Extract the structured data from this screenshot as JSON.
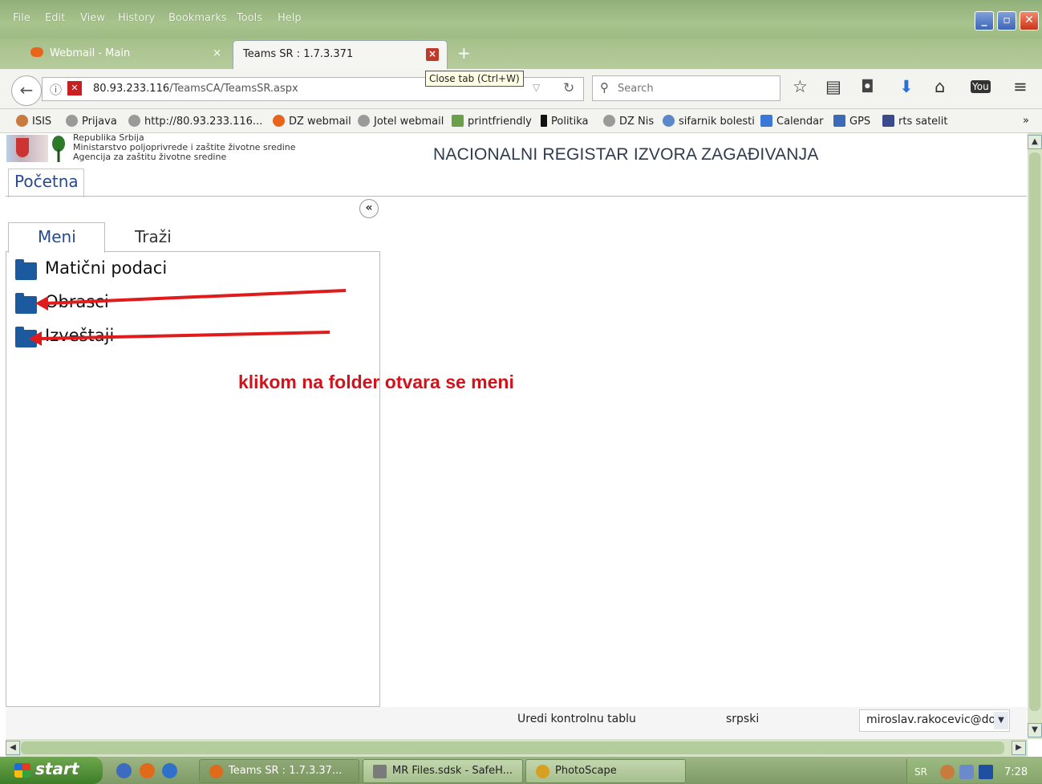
{
  "window": {
    "menu": [
      "File",
      "Edit",
      "View",
      "History",
      "Bookmarks",
      "Tools",
      "Help"
    ],
    "controls": {
      "minimize": "_",
      "restore": "▫",
      "close": "✕"
    }
  },
  "tabs": [
    {
      "label": "Webmail - Main",
      "close": "×"
    },
    {
      "label": "Teams SR : 1.7.3.371",
      "close": "×"
    }
  ],
  "new_tab_label": "+",
  "tooltip": "Close tab (Ctrl+W)",
  "urlbar": {
    "host": "80.93.233.116",
    "path": "/TeamsCA/TeamsSR.aspx"
  },
  "search": {
    "placeholder": "Search"
  },
  "bookmarks": [
    "ISIS",
    "Prijava",
    "http://80.93.233.116...",
    "DZ webmail",
    "Jotel webmail",
    "printfriendly",
    "Politika",
    "DZ Nis",
    "sifarnik bolesti",
    "Calendar",
    "GPS",
    "rts satelit"
  ],
  "bookmarks_overflow": "»",
  "header": {
    "institution": [
      "Republika Srbija",
      "Ministarstvo poljoprivrede i zaštite životne sredine",
      "Agencija za zaštitu životne sredine"
    ],
    "title": "NACIONALNI REGISTAR IZVORA ZAGAĐIVANJA"
  },
  "page_tab": "Početna",
  "collapse_label": "«",
  "subtabs": [
    "Meni",
    "Traži"
  ],
  "menu_items": [
    "Matični podaci",
    "Obrasci",
    "Izveštaji"
  ],
  "annotation": "klikom na folder otvara se meni",
  "footer": {
    "dashboard": "Uredi kontrolnu tablu",
    "language": "srpski",
    "user": "miroslav.rakocevic@do"
  },
  "taskbar": {
    "start": "start",
    "tasks": [
      "Teams SR : 1.7.3.37...",
      "MR Files.sdsk - SafeH...",
      "PhotoScape"
    ],
    "tray_lang": "SR",
    "clock": "7:28"
  },
  "colors": {
    "annotation": "#d2131b",
    "arrow": "#e01b1b",
    "folder": "#1c5aa0",
    "tab_text": "#264a8c"
  }
}
